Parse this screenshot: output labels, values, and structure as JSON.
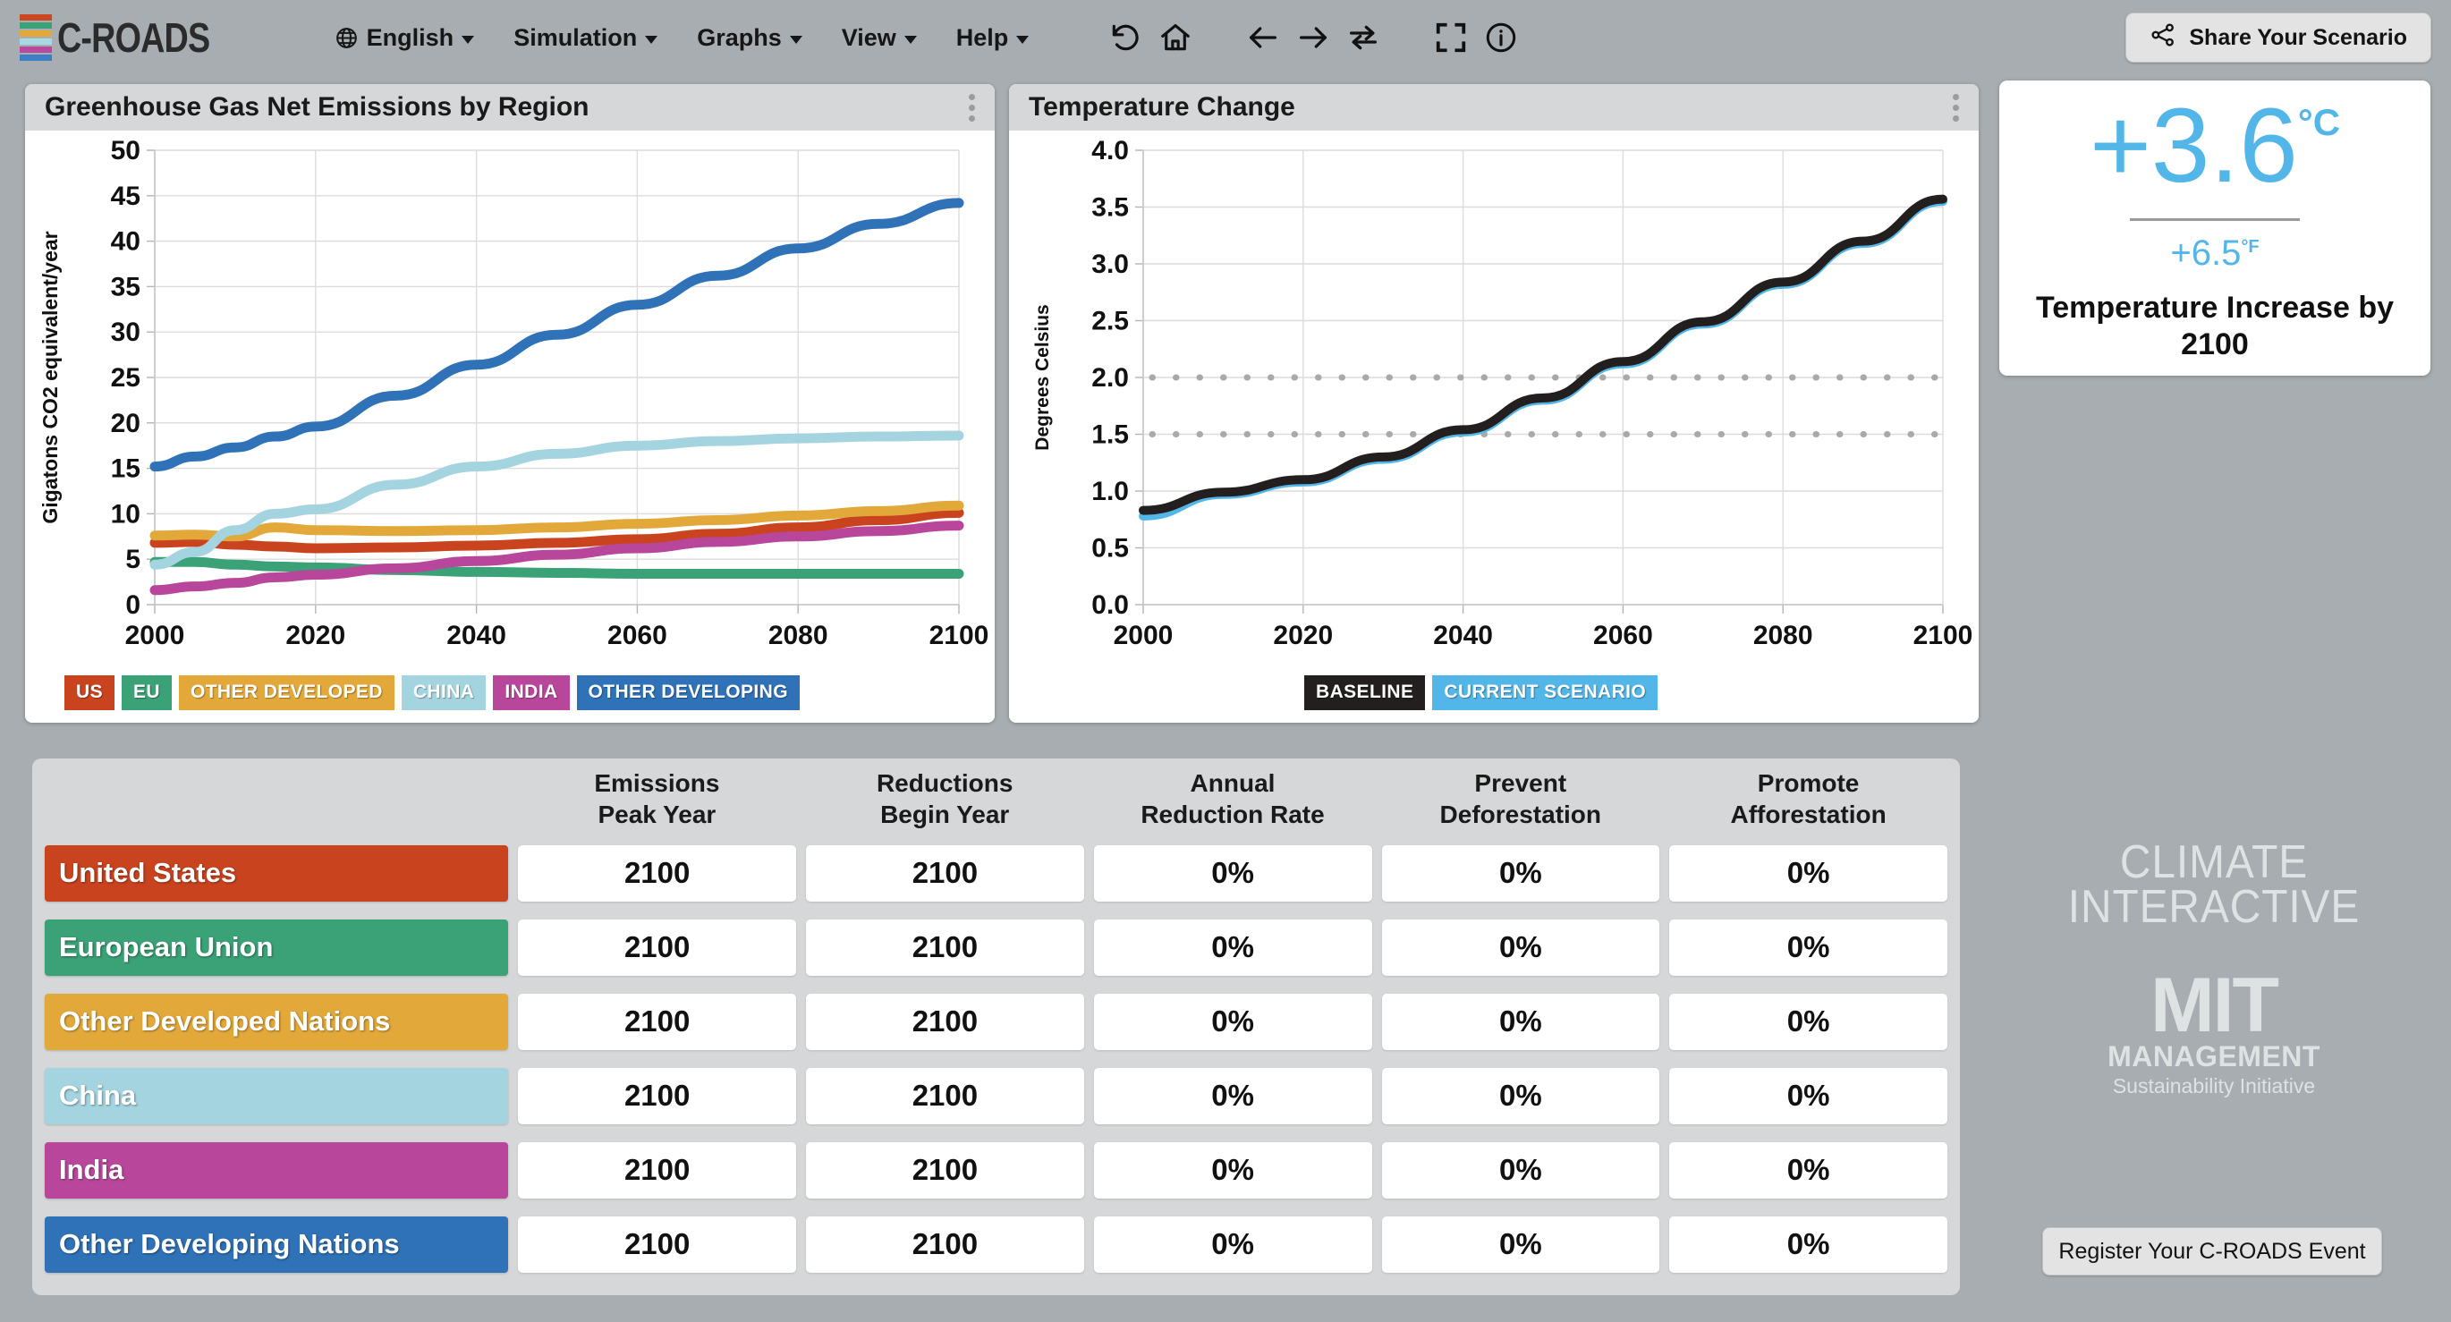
{
  "app": {
    "name": "C-ROADS",
    "logo_bar_colors": [
      "#cc4724",
      "#3ba177",
      "#e2a93a",
      "#a8d9e3",
      "#b84a9e",
      "#3b7fc4"
    ]
  },
  "topbar": {
    "language": {
      "label": "English",
      "icon": "globe-icon"
    },
    "menus": [
      {
        "label": "Simulation"
      },
      {
        "label": "Graphs"
      },
      {
        "label": "View"
      },
      {
        "label": "Help"
      }
    ],
    "tools": [
      {
        "name": "undo-icon",
        "title": "Undo"
      },
      {
        "name": "home-icon",
        "title": "Home"
      },
      {
        "name": "back-arrow-icon",
        "title": "Back"
      },
      {
        "name": "forward-arrow-icon",
        "title": "Forward"
      },
      {
        "name": "repeat-icon",
        "title": "Repeat"
      },
      {
        "name": "fullscreen-icon",
        "title": "Fullscreen"
      },
      {
        "name": "info-icon",
        "title": "Info"
      }
    ],
    "share_button": {
      "label": "Share Your Scenario",
      "icon": "share-icon"
    }
  },
  "emissions_panel": {
    "title": "Greenhouse Gas Net Emissions by Region",
    "menu_icon": "kebab-menu-icon",
    "legend": [
      {
        "label": "US",
        "color": "#c9431f"
      },
      {
        "label": "EU",
        "color": "#3ba177"
      },
      {
        "label": "OTHER DEVELOPED",
        "color": "#e2a93a"
      },
      {
        "label": "CHINA",
        "color": "#a4d4e0"
      },
      {
        "label": "INDIA",
        "color": "#b8479c"
      },
      {
        "label": "OTHER DEVELOPING",
        "color": "#2f72b8"
      }
    ]
  },
  "temperature_panel": {
    "title": "Temperature Change",
    "menu_icon": "kebab-menu-icon",
    "legend": [
      {
        "label": "BASELINE",
        "color": "#231f1e"
      },
      {
        "label": "CURRENT SCENARIO",
        "color": "#52b6e8"
      }
    ]
  },
  "temperature_card": {
    "value_c": "+3.6",
    "unit_c": "°C",
    "value_f": "+6.5",
    "unit_f": "°F",
    "caption": "Temperature Increase by 2100",
    "accent_color": "#52b6e8"
  },
  "table": {
    "columns": [
      {
        "line1": "Emissions",
        "line2": "Peak Year"
      },
      {
        "line1": "Reductions",
        "line2": "Begin Year"
      },
      {
        "line1": "Annual",
        "line2": "Reduction Rate"
      },
      {
        "line1": "Prevent",
        "line2": "Deforestation"
      },
      {
        "line1": "Promote",
        "line2": "Afforestation"
      }
    ],
    "rows": [
      {
        "region": "United States",
        "color": "#c9431f",
        "values": [
          "2100",
          "2100",
          "0%",
          "0%",
          "0%"
        ]
      },
      {
        "region": "European Union",
        "color": "#3ba177",
        "values": [
          "2100",
          "2100",
          "0%",
          "0%",
          "0%"
        ]
      },
      {
        "region": "Other Developed Nations",
        "color": "#e2a93a",
        "values": [
          "2100",
          "2100",
          "0%",
          "0%",
          "0%"
        ]
      },
      {
        "region": "China",
        "color": "#a4d4e0",
        "values": [
          "2100",
          "2100",
          "0%",
          "0%",
          "0%"
        ]
      },
      {
        "region": "India",
        "color": "#b8479c",
        "values": [
          "2100",
          "2100",
          "0%",
          "0%",
          "0%"
        ]
      },
      {
        "region": "Other Developing Nations",
        "color": "#2f72b8",
        "values": [
          "2100",
          "2100",
          "0%",
          "0%",
          "0%"
        ]
      }
    ]
  },
  "branding": {
    "climate_interactive_line1": "CLIMATE",
    "climate_interactive_line2": "INTERACTIVE",
    "mit_line1": "MIT",
    "mit_line2": "MANAGEMENT",
    "mit_line3": "Sustainability Initiative",
    "register_button": "Register Your C-ROADS Event"
  },
  "chart_data": [
    {
      "id": "emissions",
      "type": "line",
      "title": "Greenhouse Gas Net Emissions by Region",
      "xlabel": "",
      "ylabel": "Gigatons CO2 equivalent/year",
      "xlim": [
        2000,
        2100
      ],
      "ylim": [
        0,
        50
      ],
      "xticks": [
        2000,
        2020,
        2040,
        2060,
        2080,
        2100
      ],
      "yticks": [
        0,
        5,
        10,
        15,
        20,
        25,
        30,
        35,
        40,
        45,
        50
      ],
      "grid": true,
      "legend_position": "bottom",
      "x": [
        2000,
        2005,
        2010,
        2015,
        2020,
        2030,
        2040,
        2050,
        2060,
        2070,
        2080,
        2090,
        2100
      ],
      "series": [
        {
          "name": "US",
          "color": "#c9431f",
          "values": [
            6.8,
            6.9,
            6.6,
            6.4,
            6.2,
            6.3,
            6.5,
            6.8,
            7.2,
            7.8,
            8.5,
            9.3,
            10.1
          ]
        },
        {
          "name": "EU",
          "color": "#3ba177",
          "values": [
            4.7,
            4.7,
            4.4,
            4.2,
            4.1,
            3.8,
            3.6,
            3.5,
            3.4,
            3.4,
            3.4,
            3.4,
            3.4
          ]
        },
        {
          "name": "OTHER DEVELOPED",
          "color": "#e2a93a",
          "values": [
            7.6,
            7.7,
            7.5,
            8.5,
            8.2,
            8.1,
            8.2,
            8.5,
            8.9,
            9.3,
            9.8,
            10.3,
            10.9
          ]
        },
        {
          "name": "CHINA",
          "color": "#a4d4e0",
          "values": [
            4.4,
            5.8,
            8.2,
            10.0,
            10.5,
            13.2,
            15.2,
            16.6,
            17.5,
            18.0,
            18.3,
            18.5,
            18.6
          ]
        },
        {
          "name": "INDIA",
          "color": "#b8479c",
          "values": [
            1.6,
            2.0,
            2.4,
            3.0,
            3.3,
            4.0,
            4.8,
            5.5,
            6.2,
            6.9,
            7.5,
            8.1,
            8.7
          ]
        },
        {
          "name": "OTHER DEVELOPING",
          "color": "#2f72b8",
          "values": [
            15.2,
            16.3,
            17.3,
            18.5,
            19.6,
            23.0,
            26.4,
            29.7,
            33.0,
            36.2,
            39.2,
            41.9,
            44.2
          ]
        }
      ]
    },
    {
      "id": "temperature",
      "type": "line",
      "title": "Temperature Change",
      "xlabel": "",
      "ylabel": "Degrees Celsius",
      "xlim": [
        2000,
        2100
      ],
      "ylim": [
        0.0,
        4.0
      ],
      "xticks": [
        2000,
        2020,
        2040,
        2060,
        2080,
        2100
      ],
      "yticks": [
        "0.0",
        "0.5",
        "1.0",
        "1.5",
        "2.0",
        "2.5",
        "3.0",
        "3.5",
        "4.0"
      ],
      "grid": true,
      "legend_position": "bottom",
      "reference_lines": [
        1.5,
        2.0
      ],
      "x": [
        2000,
        2010,
        2020,
        2030,
        2040,
        2050,
        2060,
        2070,
        2080,
        2090,
        2100
      ],
      "series": [
        {
          "name": "CURRENT SCENARIO",
          "color": "#52b6e8",
          "values": [
            0.78,
            0.97,
            1.08,
            1.28,
            1.52,
            1.8,
            2.12,
            2.47,
            2.82,
            3.18,
            3.55
          ]
        },
        {
          "name": "BASELINE",
          "color": "#231f1e",
          "values": [
            0.83,
            0.99,
            1.1,
            1.3,
            1.54,
            1.82,
            2.14,
            2.49,
            2.84,
            3.2,
            3.57
          ]
        }
      ]
    }
  ]
}
